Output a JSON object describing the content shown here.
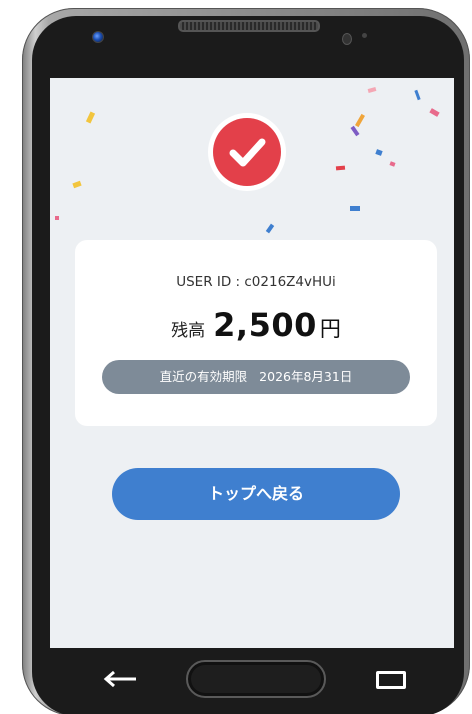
{
  "screen": {
    "user_id_text": "USER ID : c0216Z4vHUi",
    "balance": {
      "label": "残高",
      "amount": "2,500",
      "unit": "円"
    },
    "expiry": {
      "label": "直近の有効期限",
      "date": "2026年8月31日"
    },
    "back_button_label": "トップへ戻る",
    "status_icon": "check-circle-icon"
  },
  "device_nav": {
    "back_icon": "arrow-left-icon",
    "home_icon": "home-button",
    "recent_icon": "recent-apps-icon"
  },
  "colors": {
    "screen_background": "#edf0f3",
    "success_red": "#e3404a",
    "expiry_pill": "#7e8b98",
    "primary_button": "#3f7fcf"
  }
}
